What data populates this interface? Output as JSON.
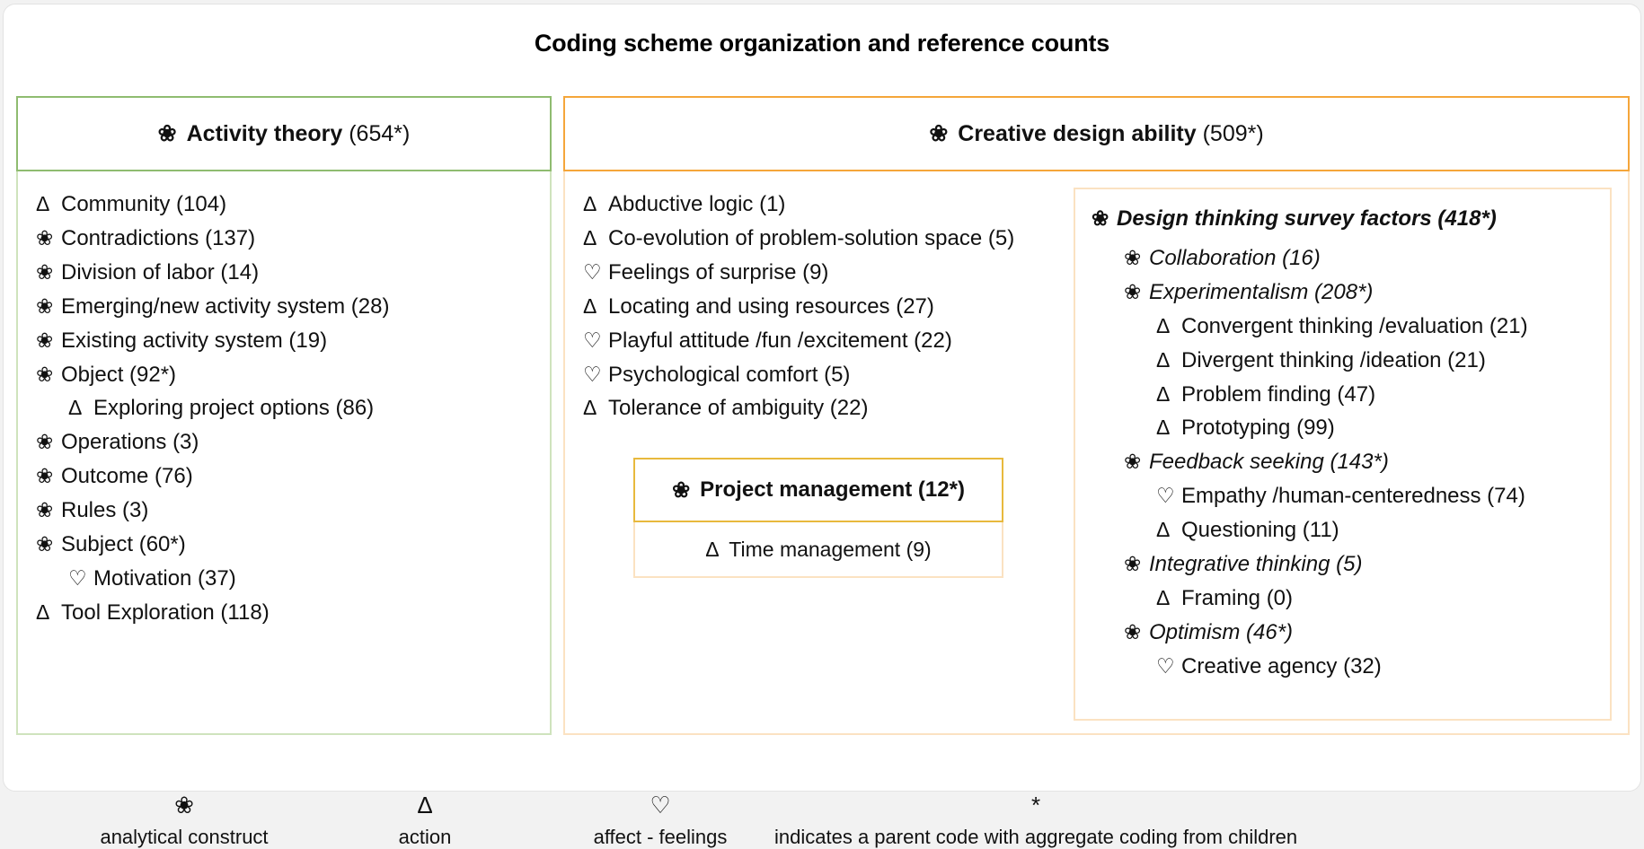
{
  "title": "Coding scheme organization and reference counts",
  "glyphs": {
    "construct": "❀",
    "action": "Δ",
    "affect": "♡",
    "asterisk": "*"
  },
  "colors": {
    "green": "#8fbc70",
    "green_light": "#cfe3bd",
    "orange": "#f5a63a",
    "orange_light": "#fbe2c2",
    "gold": "#e8b93d",
    "card_border": "#e3e3e3",
    "page_background": "#f2f2f2"
  },
  "sections": {
    "activity_theory": {
      "header_label": "Activity theory",
      "header_count": "(654*)",
      "items": [
        {
          "glyph": "Δ",
          "label": "Community (104)",
          "level": 1,
          "style": ""
        },
        {
          "glyph": "❀",
          "label": "Contradictions (137)",
          "level": 1,
          "style": ""
        },
        {
          "glyph": "❀",
          "label": "Division of labor (14)",
          "level": 1,
          "style": ""
        },
        {
          "glyph": "❀",
          "label": "Emerging/new activity system (28)",
          "level": 1,
          "style": ""
        },
        {
          "glyph": "❀",
          "label": "Existing activity system (19)",
          "level": 1,
          "style": ""
        },
        {
          "glyph": "❀",
          "label": "Object (92*)",
          "level": 1,
          "style": ""
        },
        {
          "glyph": "Δ",
          "label": "Exploring project options (86)",
          "level": 2,
          "style": ""
        },
        {
          "glyph": "❀",
          "label": "Operations (3)",
          "level": 1,
          "style": ""
        },
        {
          "glyph": "❀",
          "label": "Outcome (76)",
          "level": 1,
          "style": ""
        },
        {
          "glyph": "❀",
          "label": "Rules (3)",
          "level": 1,
          "style": ""
        },
        {
          "glyph": "❀",
          "label": "Subject (60*)",
          "level": 1,
          "style": ""
        },
        {
          "glyph": "♡",
          "label": "Motivation (37)",
          "level": 2,
          "style": ""
        },
        {
          "glyph": "Δ",
          "label": "Tool Exploration (118)",
          "level": 1,
          "style": ""
        }
      ]
    },
    "creative_design_ability": {
      "header_label": "Creative design ability",
      "header_count": "(509*)",
      "items": [
        {
          "glyph": "Δ",
          "label": "Abductive logic (1)",
          "level": 1,
          "style": ""
        },
        {
          "glyph": "Δ",
          "label": "Co-evolution of problem-solution space (5)",
          "level": 1,
          "style": ""
        },
        {
          "glyph": "♡",
          "label": "Feelings of surprise (9)",
          "level": 1,
          "style": ""
        },
        {
          "glyph": "Δ",
          "label": "Locating and using resources (27)",
          "level": 1,
          "style": ""
        },
        {
          "glyph": "♡",
          "label": "Playful attitude /fun /excitement (22)",
          "level": 1,
          "style": ""
        },
        {
          "glyph": "♡",
          "label": "Psychological comfort (5)",
          "level": 1,
          "style": ""
        },
        {
          "glyph": "Δ",
          "label": "Tolerance of ambiguity (22)",
          "level": 1,
          "style": ""
        }
      ]
    },
    "project_management": {
      "header_label": "Project management (12*)",
      "body_glyph": "Δ",
      "body_label": "Time management (9)"
    },
    "design_thinking_survey_factors": {
      "header_glyph": "❀",
      "header_label": "Design thinking survey factors (418*)",
      "items": [
        {
          "glyph": "❀",
          "label": "Collaboration (16)",
          "level": 3,
          "style": "em"
        },
        {
          "glyph": "❀",
          "label": "Experimentalism (208*)",
          "level": 3,
          "style": "em"
        },
        {
          "glyph": "Δ",
          "label": "Convergent thinking /evaluation (21)",
          "level": 4,
          "style": ""
        },
        {
          "glyph": "Δ",
          "label": "Divergent thinking /ideation (21)",
          "level": 4,
          "style": ""
        },
        {
          "glyph": "Δ",
          "label": "Problem finding (47)",
          "level": 4,
          "style": ""
        },
        {
          "glyph": "Δ",
          "label": "Prototyping (99)",
          "level": 4,
          "style": ""
        },
        {
          "glyph": "❀",
          "label": "Feedback seeking (143*)",
          "level": 3,
          "style": "em"
        },
        {
          "glyph": "♡",
          "label": "Empathy /human-centeredness (74)",
          "level": 4,
          "style": ""
        },
        {
          "glyph": "Δ",
          "label": "Questioning (11)",
          "level": 4,
          "style": ""
        },
        {
          "glyph": "❀",
          "label": "Integrative thinking (5)",
          "level": 3,
          "style": "em"
        },
        {
          "glyph": "Δ",
          "label": "Framing (0)",
          "level": 4,
          "style": ""
        },
        {
          "glyph": "❀",
          "label": "Optimism (46*)",
          "level": 3,
          "style": "em"
        },
        {
          "glyph": "♡",
          "label": "Creative agency (32)",
          "level": 4,
          "style": ""
        }
      ]
    }
  },
  "legend": [
    {
      "glyph": "❀",
      "label": "analytical construct"
    },
    {
      "glyph": "Δ",
      "label": "action"
    },
    {
      "glyph": "♡",
      "label": "affect - feelings"
    },
    {
      "glyph": "*",
      "label": "indicates a parent code with aggregate coding from children"
    }
  ]
}
